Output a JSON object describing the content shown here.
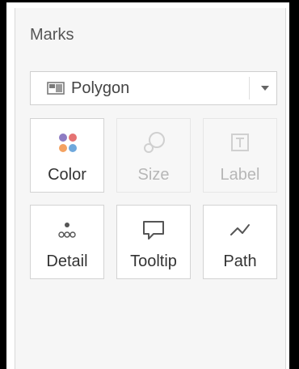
{
  "marks_panel": {
    "title": "Marks",
    "mark_type_select": {
      "value": "Polygon",
      "icon": "polygon-icon",
      "dropdown_icon": "chevron-down-icon"
    },
    "cards": [
      {
        "label": "Color",
        "icon": "color-icon",
        "enabled": true
      },
      {
        "label": "Size",
        "icon": "size-icon",
        "enabled": false
      },
      {
        "label": "Label",
        "icon": "label-icon",
        "enabled": false
      },
      {
        "label": "Detail",
        "icon": "detail-icon",
        "enabled": true
      },
      {
        "label": "Tooltip",
        "icon": "tooltip-icon",
        "enabled": true
      },
      {
        "label": "Path",
        "icon": "path-icon",
        "enabled": true
      }
    ]
  },
  "colors": {
    "panel_background": "#f6f6f6",
    "dot_purple": "#8e7cc3",
    "dot_red": "#e57373",
    "dot_orange": "#f4a261",
    "dot_blue": "#6fa8dc"
  }
}
